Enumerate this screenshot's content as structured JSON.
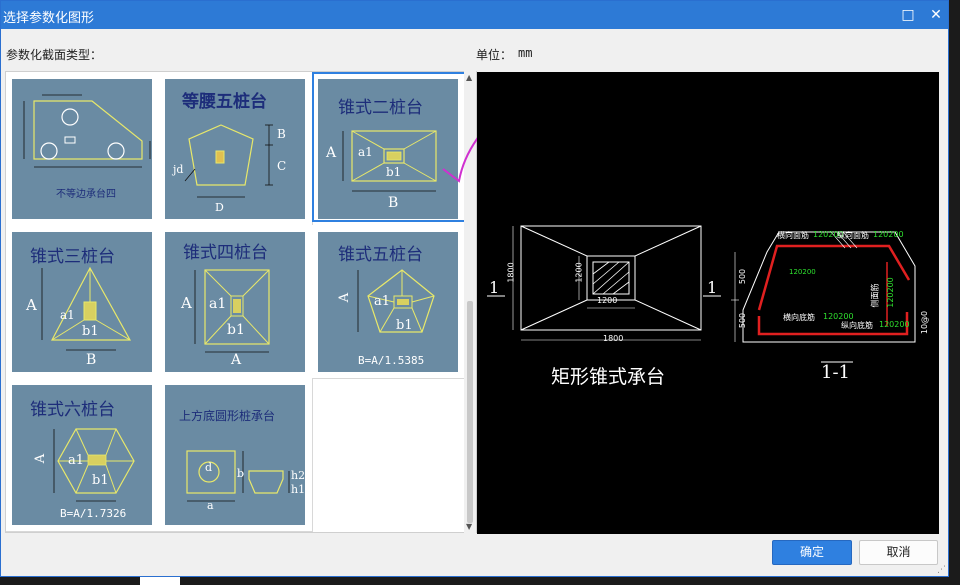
{
  "window": {
    "title": "选择参数化图形",
    "maximize_icon": "□",
    "close_icon": "✕"
  },
  "labels": {
    "section_type": "参数化截面类型：",
    "unit_label": "单位：",
    "unit_value": "mm"
  },
  "shapes": [
    {
      "name": "不等边承台四",
      "caption": "不等边承台四",
      "sub": ""
    },
    {
      "name": "等腰五桩台",
      "caption": "等腰五桩台",
      "sub": ""
    },
    {
      "name": "锥式二桩台",
      "caption": "锥式二桩台",
      "sub": "",
      "selected": true
    },
    {
      "name": "锥式三桩台",
      "caption": "锥式三桩台",
      "sub": ""
    },
    {
      "name": "锥式四桩台",
      "caption": "锥式四桩台",
      "sub": ""
    },
    {
      "name": "锥式五桩台",
      "caption": "锥式五桩台",
      "sub": "B=A/1.5385"
    },
    {
      "name": "锥式六桩台",
      "caption": "锥式六桩台",
      "sub": "B=A/1.7326"
    },
    {
      "name": "上方底圆形桩承台",
      "caption": "上方底圆形桩承台",
      "sub": ""
    }
  ],
  "thumb_labels": {
    "A": "A",
    "B": "B",
    "C": "C",
    "D": "D",
    "a1": "a1",
    "b1": "b1",
    "jd": "jd",
    "a": "a",
    "b": "b",
    "d": "d",
    "h1": "h1",
    "h2": "h2"
  },
  "preview": {
    "plan_title": "矩形锥式承台",
    "section_title": "1-1",
    "section_mark": "1",
    "dim_1800_w": "1800",
    "dim_1800_h": "1800",
    "dim_1200_w": "1200",
    "dim_1200_h": "1200",
    "dim_500_a": "500",
    "dim_500_b": "500",
    "label_top_h": "横向面筋",
    "label_top_v": "纵向面筋",
    "label_bot_h": "横向底筋",
    "label_bot_v": "纵向底筋",
    "label_side": "侧面筋",
    "bar_spec_1": "120200",
    "bar_spec_2": "120200",
    "bar_spec_3": "120200",
    "bar_spec_4": "120200",
    "bar_spec_5": "10@0",
    "bar_spec_6": "120200",
    "bar_spec_7": "120200"
  },
  "buttons": {
    "ok": "确定",
    "cancel": "取消"
  },
  "colors": {
    "title_bar": "#2d7ad6",
    "thumb_bg": "#6a8ba3",
    "line_yellow": "#e8e86a",
    "caption_blue": "#1d2d7a",
    "rebar_red": "#e02020",
    "selection": "#2f80e0"
  }
}
